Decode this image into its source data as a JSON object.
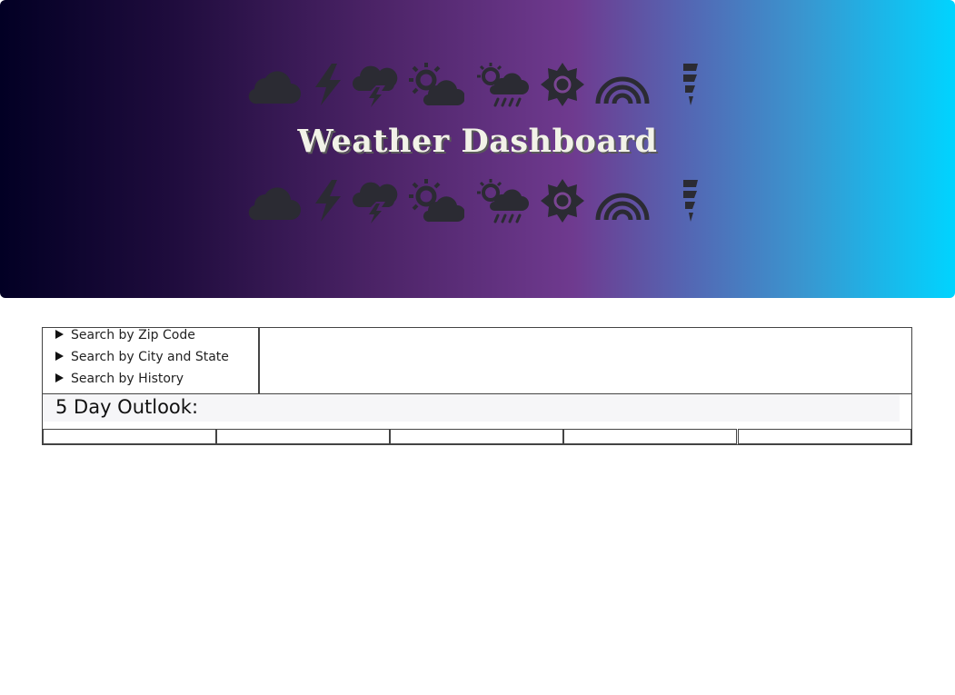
{
  "header": {
    "title": "Weather Dashboard",
    "icons": [
      "cloud-icon",
      "lightning-icon",
      "thunderstorm-icon",
      "partly-cloudy-icon",
      "sun-rain-icon",
      "sun-icon",
      "rainbow-icon",
      "tornado-icon"
    ],
    "icon_color": "#2b2b33"
  },
  "search": {
    "items": [
      {
        "label": "Search by Zip Code"
      },
      {
        "label": "Search by City and State"
      },
      {
        "label": "Search by History"
      }
    ]
  },
  "forecast": {
    "heading": "5 Day Outlook:",
    "days": 5
  },
  "colors": {
    "gradient_start": "#020024",
    "gradient_mid": "#6f3a8f",
    "gradient_end": "#00d4ff",
    "border": "#444444"
  }
}
